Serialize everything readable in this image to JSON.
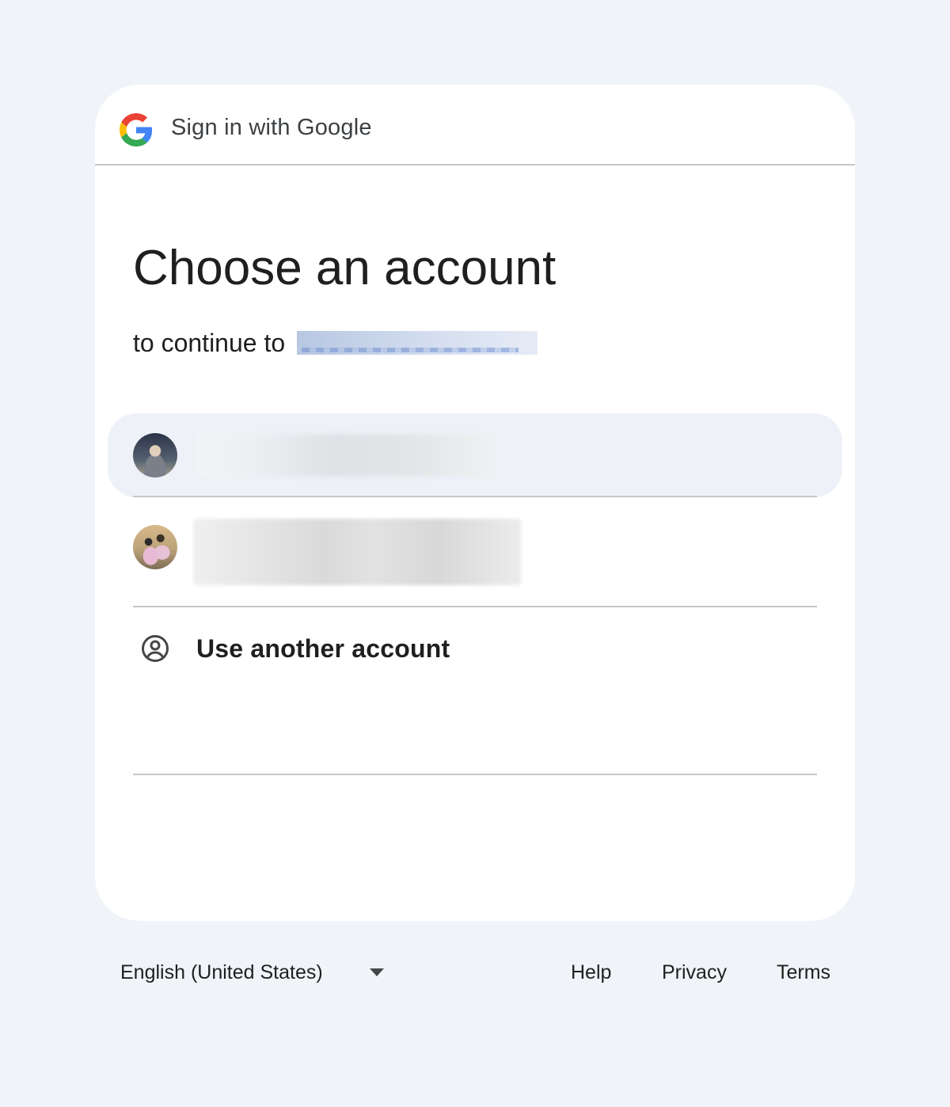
{
  "header": {
    "title": "Sign in with Google",
    "logo_icon": "google-g-logo"
  },
  "main": {
    "heading": "Choose an account",
    "subtitle_prefix": "to continue to",
    "app_name_redacted": true
  },
  "accounts": [
    {
      "avatar": "user-photo",
      "name_redacted": true,
      "highlighted": true
    },
    {
      "avatar": "user-photo",
      "name_redacted": true,
      "highlighted": false
    }
  ],
  "another_account": {
    "label": "Use another account",
    "icon": "account-circle-icon"
  },
  "footer": {
    "language": "English (United States)",
    "language_icon": "dropdown-arrow-icon",
    "links": {
      "help": "Help",
      "privacy": "Privacy",
      "terms": "Terms"
    }
  },
  "colors": {
    "page_background": "#f0f4f9",
    "card_background": "#ffffff",
    "highlight_row": "#eef2f8",
    "divider": "#c4c7c5",
    "text_primary": "#1f1f1f",
    "google_blue": "#4285F4",
    "google_red": "#EA4335",
    "google_yellow": "#FBBC05",
    "google_green": "#34A853"
  }
}
